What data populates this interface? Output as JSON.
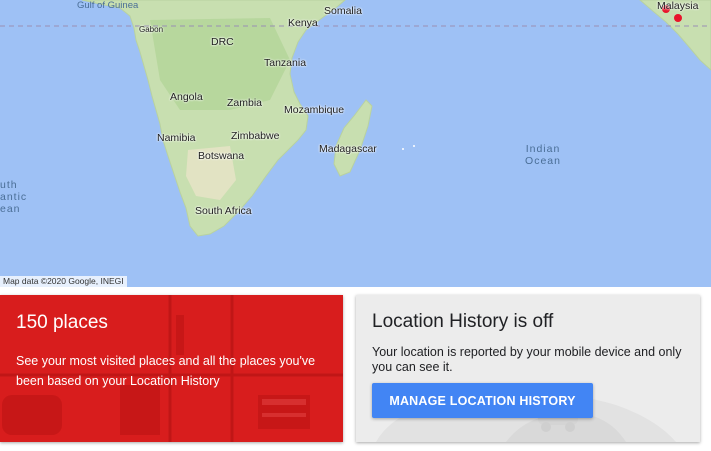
{
  "map": {
    "labels": {
      "gulf_of_guinea": "Gulf of Guinea",
      "somalia": "Somalia",
      "kenya": "Kenya",
      "gabon": "Gabon",
      "drc": "DRC",
      "tanzania": "Tanzania",
      "angola": "Angola",
      "zambia": "Zambia",
      "mozambique": "Mozambique",
      "namibia": "Namibia",
      "zimbabwe": "Zimbabwe",
      "botswana": "Botswana",
      "madagascar": "Madagascar",
      "south_africa": "South Africa",
      "malaysia": "Malaysia",
      "indian_ocean_1": "Indian",
      "indian_ocean_2": "Ocean",
      "atlantic_1": "uth",
      "atlantic_2": "antic",
      "atlantic_3": "ean"
    },
    "attribution": "Map data ©2020 Google, INEGI",
    "colors": {
      "water": "#8ab4f8",
      "land": "#c8dfb0",
      "marker": "#e8142b"
    }
  },
  "places_card": {
    "title": "150 places",
    "description": "See your most visited places and all the places you've been based on your Location History",
    "color": "#d81d1d"
  },
  "history_card": {
    "title": "Location History is off",
    "description": "Your location is reported by your mobile device and only you can see it.",
    "button_label": "MANAGE LOCATION HISTORY",
    "button_color": "#4285f4"
  }
}
